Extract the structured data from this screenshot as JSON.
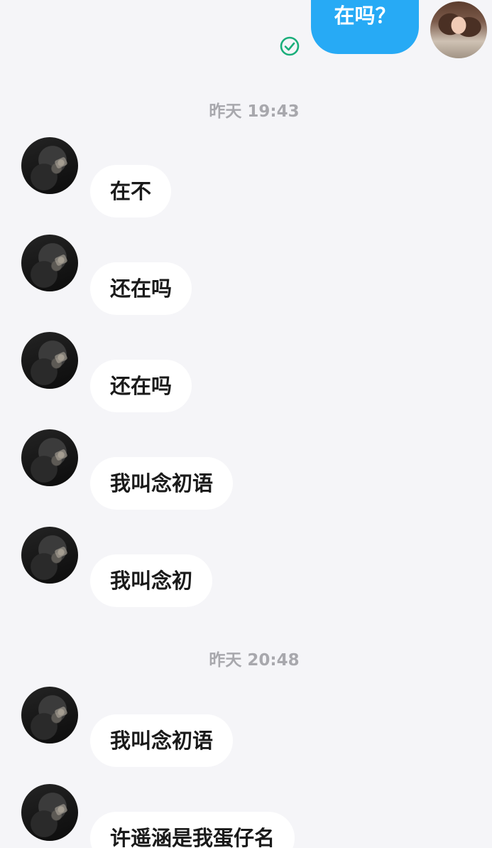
{
  "colors": {
    "background": "#f5f5f8",
    "self_bubble": "#27aaf5",
    "other_bubble": "#ffffff",
    "timestamp": "#a8a8ad",
    "read_check": "#1aae7a"
  },
  "messages": {
    "m0": {
      "sender": "self",
      "text": "在吗？",
      "status_icon": "check-circle-icon"
    },
    "sep1": {
      "text": "昨天 19:43"
    },
    "m1": {
      "sender": "other",
      "text": "在不"
    },
    "m2": {
      "sender": "other",
      "text": "还在吗"
    },
    "m3": {
      "sender": "other",
      "text": "还在吗"
    },
    "m4": {
      "sender": "other",
      "text": "我叫念初语"
    },
    "m5": {
      "sender": "other",
      "text": "我叫念初"
    },
    "sep2": {
      "text": "昨天 20:48"
    },
    "m6": {
      "sender": "other",
      "text": "我叫念初语"
    },
    "m7": {
      "sender": "other",
      "text": "许遥涵是我蛋仔名"
    }
  }
}
